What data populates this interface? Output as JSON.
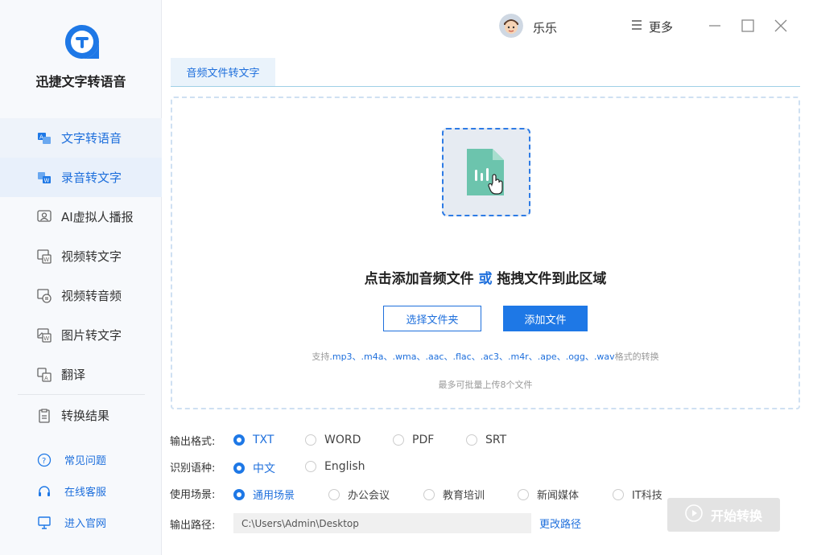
{
  "app": {
    "name": "迅捷文字转语音"
  },
  "sidebar": {
    "items": [
      {
        "label": "文字转语音",
        "icon": "text-to-speech-icon"
      },
      {
        "label": "录音转文字",
        "icon": "audio-to-text-icon",
        "active": true
      },
      {
        "label": "AI虚拟人播报",
        "icon": "ai-avatar-icon"
      },
      {
        "label": "视频转文字",
        "icon": "video-to-text-icon"
      },
      {
        "label": "视频转音频",
        "icon": "video-to-audio-icon"
      },
      {
        "label": "图片转文字",
        "icon": "image-to-text-icon"
      },
      {
        "label": "翻译",
        "icon": "translate-icon"
      }
    ],
    "result": {
      "label": "转换结果",
      "icon": "result-icon"
    },
    "links": [
      {
        "label": "常见问题",
        "icon": "help-icon"
      },
      {
        "label": "在线客服",
        "icon": "headset-icon"
      },
      {
        "label": "进入官网",
        "icon": "monitor-icon"
      }
    ]
  },
  "header": {
    "user_name": "乐乐",
    "more_label": "更多"
  },
  "tab": {
    "label": "音频文件转文字"
  },
  "dropzone": {
    "title_part1": "点击添加音频文件",
    "title_or": "或",
    "title_part2": "拖拽文件到此区域",
    "select_folder": "选择文件夹",
    "add_file": "添加文件",
    "support_prefix": "支持",
    "support_formats": ".mp3、.m4a、.wma、.aac、.flac、.ac3、.m4r、.ape、.ogg、.wav",
    "support_suffix": "格式的转换",
    "limit": "最多可批量上传8个文件"
  },
  "options": {
    "format": {
      "label": "输出格式:",
      "options": [
        "TXT",
        "WORD",
        "PDF",
        "SRT"
      ],
      "selected": "TXT"
    },
    "language": {
      "label": "识别语种:",
      "options": [
        "中文",
        "English"
      ],
      "selected": "中文"
    },
    "scene": {
      "label": "使用场景:",
      "options": [
        "通用场景",
        "办公会议",
        "教育培训",
        "新闻媒体",
        "IT科技"
      ],
      "selected": "通用场景"
    },
    "path": {
      "label": "输出路径:",
      "value": "C:\\Users\\Admin\\Desktop",
      "change_label": "更改路径"
    }
  },
  "start_button": {
    "label": "开始转换"
  },
  "colors": {
    "accent": "#1e78e6",
    "active_bg": "#e8f0fb",
    "file_icon": "#6cc4ad"
  }
}
